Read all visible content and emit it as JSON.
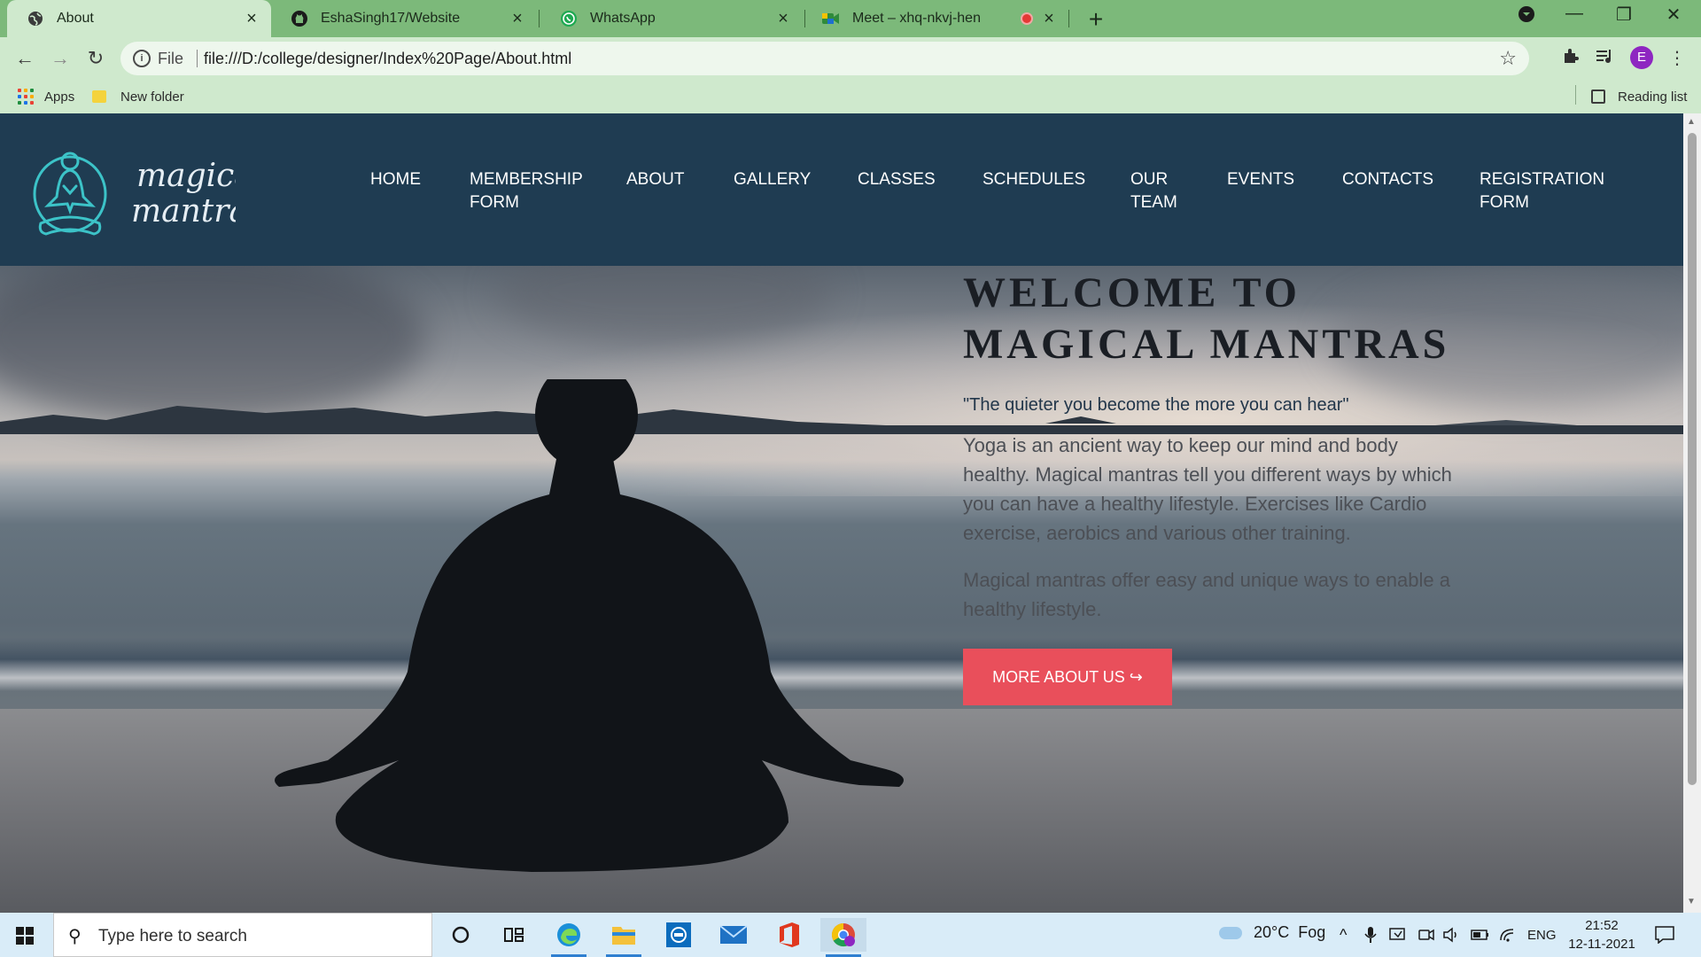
{
  "browser": {
    "tabs": [
      {
        "title": "About",
        "icon": "globe-icon",
        "active": true
      },
      {
        "title": "EshaSingh17/Website",
        "icon": "github-icon",
        "active": false
      },
      {
        "title": "WhatsApp",
        "icon": "whatsapp-icon",
        "active": false
      },
      {
        "title": "Meet – xhq-nkvj-hen",
        "icon": "meet-icon",
        "active": false,
        "recording": true
      }
    ],
    "address": {
      "scheme_label": "File",
      "url": "file:///D:/college/designer/Index%20Page/About.html"
    },
    "profile_initial": "E",
    "bookmarks": {
      "apps_label": "Apps",
      "folder_label": "New folder",
      "reading_list_label": "Reading list"
    }
  },
  "site": {
    "logo_text": [
      "magical",
      "mantras"
    ],
    "nav": [
      {
        "label": "HOME"
      },
      {
        "label": "MEMBERSHIP FORM"
      },
      {
        "label": "ABOUT"
      },
      {
        "label": "GALLERY"
      },
      {
        "label": "CLASSES"
      },
      {
        "label": "SCHEDULES"
      },
      {
        "label": "OUR TEAM"
      },
      {
        "label": "EVENTS"
      },
      {
        "label": "CONTACTS"
      },
      {
        "label": "REGISTRATION FORM"
      }
    ],
    "hero": {
      "title": "WELCOME TO MAGICAL MANTRAS",
      "quote": "\"The quieter you become the more you can hear\"",
      "paragraph1": "Yoga is an ancient way to keep our mind and body healthy. Magical mantras tell you different ways by which you can have a healthy lifestyle. Exercises like Cardio exercise, aerobics and various other training.",
      "paragraph2": "Magical mantras offer easy and unique ways to enable a healthy lifestyle.",
      "button_label": "MORE ABOUT US ↪"
    },
    "colors": {
      "header_bg": "#1f3c52",
      "button_bg": "#e94f5b",
      "logo_accent": "#3cc3c8"
    }
  },
  "taskbar": {
    "search_placeholder": "Type here to search",
    "weather": "20°C  Fog",
    "language": "ENG",
    "time": "21:52",
    "date": "12-11-2021"
  }
}
